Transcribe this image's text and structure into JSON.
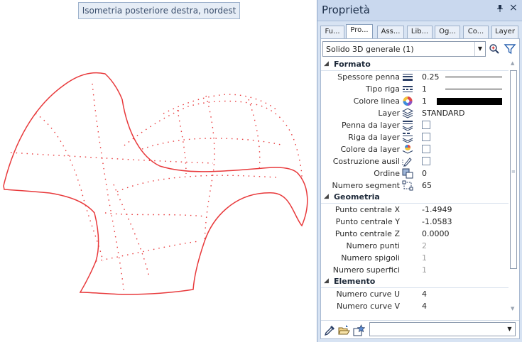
{
  "viewport": {
    "view_label": "Isometria posteriore destra, nordest"
  },
  "palette": {
    "title": "Proprietà",
    "pin_glyph": "ᵽ",
    "close_glyph": "×",
    "tabs": [
      {
        "label": "Fu..."
      },
      {
        "label": "Pro...",
        "active": true
      },
      {
        "label": "Ass..."
      },
      {
        "label": "Lib..."
      },
      {
        "label": "Og..."
      },
      {
        "label": "Co..."
      },
      {
        "label": "Layer"
      }
    ],
    "selector": {
      "value": "Solido 3D generale (1)",
      "zoom_icon": "zoom-in-icon",
      "filter_icon": "filter-icon"
    },
    "sections": {
      "formato": "Formato",
      "geometria": "Geometria",
      "elemento": "Elemento"
    },
    "formato": {
      "spessore_penna": {
        "label": "Spessore penna",
        "value": "0.25"
      },
      "tipo_riga": {
        "label": "Tipo riga",
        "value": "1"
      },
      "colore_linea": {
        "label": "Colore linea",
        "value": "1",
        "swatch": "#000000"
      },
      "layer": {
        "label": "Layer",
        "value": "STANDARD"
      },
      "penna_da_layer": {
        "label": "Penna da layer"
      },
      "riga_da_layer": {
        "label": "Riga da layer"
      },
      "colore_da_layer": {
        "label": "Colore da layer"
      },
      "costruzione_ausil": {
        "label": "Costruzione ausil"
      },
      "ordine": {
        "label": "Ordine",
        "value": "0"
      },
      "numero_segment": {
        "label": "Numero segment",
        "value": "65"
      }
    },
    "geometria": {
      "punto_x": {
        "label": "Punto centrale X",
        "value": "-1.4949"
      },
      "punto_y": {
        "label": "Punto centrale Y",
        "value": "-1.0583"
      },
      "punto_z": {
        "label": "Punto centrale Z",
        "value": "0.0000"
      },
      "numero_punti": {
        "label": "Numero punti",
        "value": "2"
      },
      "numero_spigoli": {
        "label": "Numero spigoli",
        "value": "1"
      },
      "numero_superfici": {
        "label": "Numero superfici",
        "value": "1"
      }
    },
    "elemento": {
      "curve_u": {
        "label": "Numero curve U",
        "value": "4"
      },
      "curve_v": {
        "label": "Numero curve V",
        "value": "4"
      }
    },
    "bottom": {
      "combo_value": ""
    }
  },
  "colors": {
    "model_line": "#e8393b",
    "panel_bg": "#d7e3f3",
    "accent": "#1f6fd0"
  }
}
